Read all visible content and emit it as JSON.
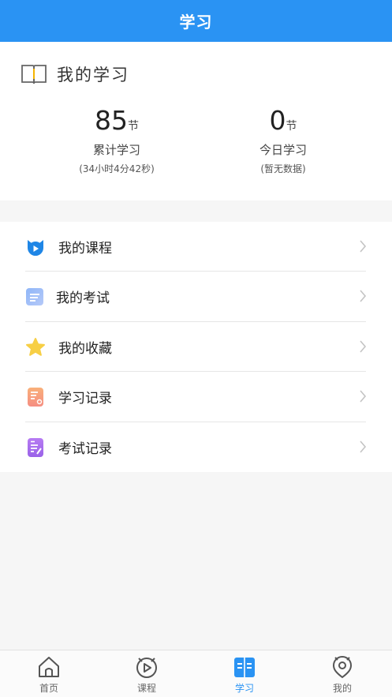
{
  "header": {
    "title": "学习"
  },
  "summary": {
    "title": "我的学习",
    "book_icon": "open-book-icon",
    "total": {
      "value": "85",
      "unit": "节",
      "label": "累计学习",
      "detail": "(34小时4分42秒)"
    },
    "today": {
      "value": "0",
      "unit": "节",
      "label": "今日学习",
      "detail": "(暂无数据)"
    }
  },
  "menu": {
    "items": [
      {
        "label": "我的课程",
        "icon": "course-play-icon"
      },
      {
        "label": "我的考试",
        "icon": "exam-icon"
      },
      {
        "label": "我的收藏",
        "icon": "star-icon"
      },
      {
        "label": "学习记录",
        "icon": "study-record-icon"
      },
      {
        "label": "考试记录",
        "icon": "exam-record-icon"
      }
    ]
  },
  "tabbar": {
    "tabs": [
      {
        "label": "首页",
        "icon": "home-icon",
        "active": false
      },
      {
        "label": "课程",
        "icon": "course-icon",
        "active": false
      },
      {
        "label": "学习",
        "icon": "study-book-icon",
        "active": true
      },
      {
        "label": "我的",
        "icon": "profile-icon",
        "active": false
      }
    ]
  },
  "colors": {
    "accent": "#2a93f3",
    "background": "#f6f6f6"
  }
}
